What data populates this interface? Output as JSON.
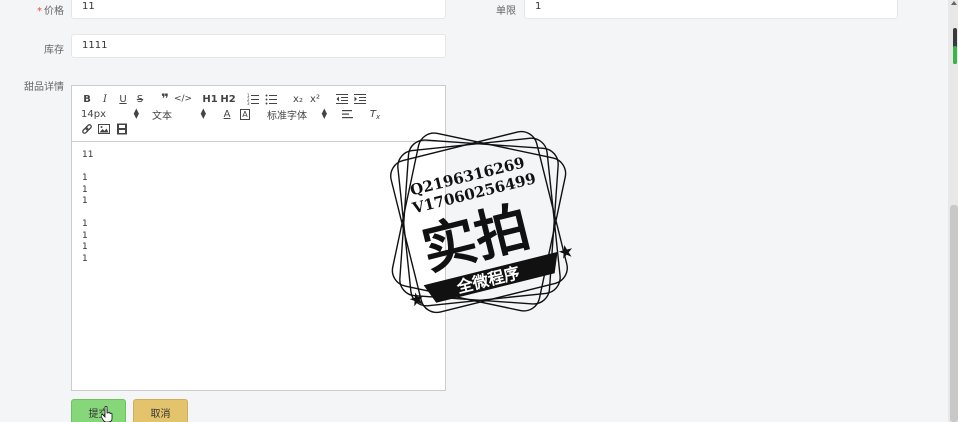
{
  "form": {
    "price": {
      "label": "价格",
      "required_mark": "*",
      "value": "11"
    },
    "limit": {
      "label": "单限",
      "value": "1"
    },
    "stock": {
      "label": "库存",
      "value": "1111"
    },
    "detail": {
      "label": "甜品详情"
    }
  },
  "editor": {
    "toolbar": {
      "font_size": "14px",
      "block_type": "文本",
      "font_family": "标准字体",
      "h1": "H1",
      "h2": "H2",
      "sub": "x₂",
      "sup": "x²"
    },
    "lines": [
      "11",
      "",
      "1",
      "1",
      "1",
      "",
      "1",
      "1",
      "1",
      "1"
    ]
  },
  "watermark": {
    "line1": "Q2196316269",
    "line2": "V17060256499",
    "main": "实拍",
    "banner": "全微程序"
  },
  "buttons": {
    "submit": "提交",
    "cancel": "取消"
  },
  "colors": {
    "submit_bg": "#86d67a",
    "cancel_bg": "#e3c36c"
  }
}
